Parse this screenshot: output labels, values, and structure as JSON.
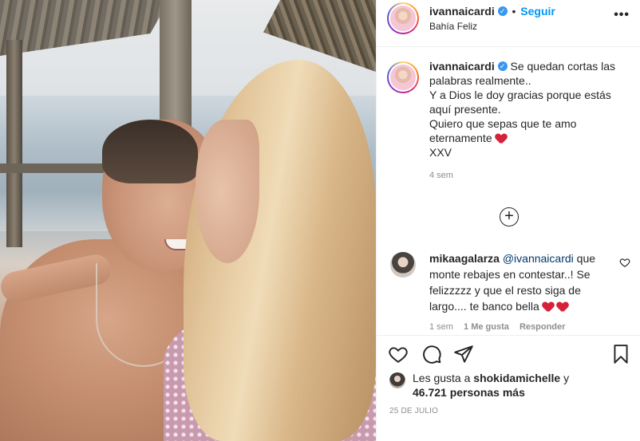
{
  "post": {
    "username": "ivannaicardi",
    "follow_label": "Seguir",
    "dot": "•",
    "location": "Bahía Feliz",
    "more_label": "•••"
  },
  "caption": {
    "username": "ivannaicardi",
    "lines": [
      "Se quedan cortas las palabras realmente..",
      "Y a Dios le doy gracias porque estás aquí presente.",
      "Quiero que sepas que te amo eternamente",
      "XXV"
    ],
    "time": "4 sem"
  },
  "comment": {
    "username": "mikaagalarza",
    "mention": "@ivannaicardi",
    "text": "que monte rebajes en contestar..! Se felizzzzz y que el resto siga de largo.... te banco bella",
    "time": "1 sem",
    "likes": "1 Me gusta",
    "reply": "Responder"
  },
  "likes": {
    "prefix": "Les gusta a",
    "user": "shokidamichelle",
    "suffix": "y",
    "count": "46.721 personas más"
  },
  "date": "25 DE JULIO",
  "colors": {
    "link": "#0095f6",
    "verified": "#3897f0",
    "muted": "#8e8e8e"
  }
}
